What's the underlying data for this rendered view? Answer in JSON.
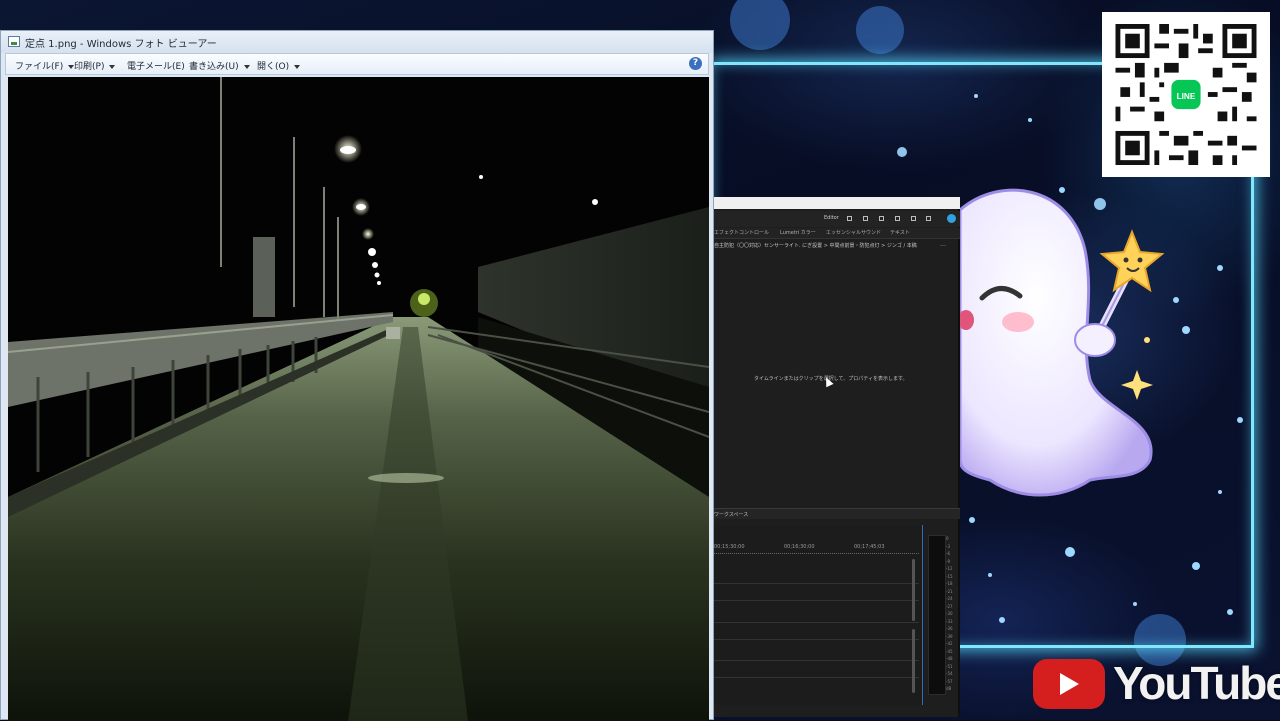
{
  "photo_viewer": {
    "title": "定点 1.png - Windows フォト ビューアー",
    "menu": [
      {
        "label": "ファイル(F)",
        "has_dropdown": true
      },
      {
        "label": "印刷(P)",
        "has_dropdown": true
      },
      {
        "label": "電子メール(E)",
        "has_dropdown": false
      },
      {
        "label": "書き込み(U)",
        "has_dropdown": true
      },
      {
        "label": "開く(O)",
        "has_dropdown": true
      }
    ],
    "help_label": "?"
  },
  "editor": {
    "workspace_label": "Editor",
    "tabs": [
      "エフェクトコントロール",
      "Lumetri カラー",
      "エッセンシャルサウンド",
      "テキスト"
    ],
    "path": "自主防犯（〇〇対応）センサーライト. にぎ設置 > 中間点前景・防犯点灯 > ジンゴ / 本稿",
    "more": "…",
    "message": "タイムラインまたはクリップを選択して、プロパティを表示します。",
    "timeline_label": "ワークスペース",
    "timecodes": [
      "00;15;30;00",
      "00;16;30;00",
      "00;17;45;03"
    ],
    "meter_ticks": [
      "0",
      "-3",
      "-6",
      "-9",
      "-12",
      "-15",
      "-18",
      "-21",
      "-24",
      "-27",
      "-30",
      "-33",
      "-36",
      "-39",
      "-42",
      "-45",
      "-48",
      "-51",
      "-54",
      "-57",
      "dB"
    ]
  },
  "overlay": {
    "youtube_text": "YouTube",
    "line_label": "LINE"
  },
  "colors": {
    "frame_glow": "#7fe8ff",
    "youtube_red": "#d51e1e",
    "line_green": "#06c755"
  }
}
